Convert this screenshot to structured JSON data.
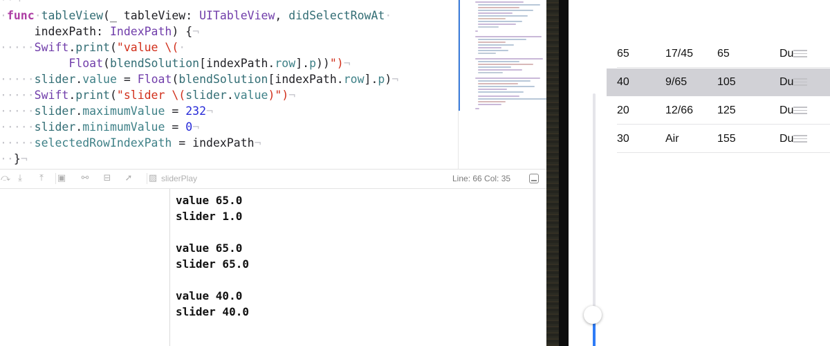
{
  "editor": {
    "lines": {
      "l1a": "func",
      "l1b": "tableView",
      "l1c": "(_ tableView: ",
      "l1d": "UITableView",
      "l1e": ", ",
      "l1f": "didSelectRowAt",
      "l2a": "indexPath: ",
      "l2b": "IndexPath",
      "l2c": ") {",
      "l3a": "Swift",
      "l3b": ".",
      "l3c": "print",
      "l3d": "(",
      "l3e": "\"value \\(",
      "l4a": "Float",
      "l4b": "(",
      "l4c": "blendSolution",
      "l4d": "[indexPath.",
      "l4e": "row",
      "l4f": "].",
      "l4g": "p",
      "l4h": "))",
      "l4i": "\")",
      "l5a": "slider",
      "l5b": ".",
      "l5c": "value",
      "l5d": " = ",
      "l5e": "Float",
      "l5f": "(",
      "l5g": "blendSolution",
      "l5h": "[indexPath.",
      "l5i": "row",
      "l5j": "].",
      "l5k": "p",
      "l5l": ")",
      "l6a": "Swift",
      "l6b": ".",
      "l6c": "print",
      "l6d": "(",
      "l6e": "\"slider \\(",
      "l6f": "slider",
      "l6g": ".",
      "l6h": "value",
      "l6i": ")\")",
      "l7a": "slider",
      "l7b": ".",
      "l7c": "maximumValue",
      "l7d": " = ",
      "l7e": "232",
      "l8a": "slider",
      "l8b": ".",
      "l8c": "minimumValue",
      "l8d": " = ",
      "l8e": "0",
      "l9a": "selectedRowIndexPath",
      "l9b": " = indexPath",
      "l10a": "}"
    }
  },
  "statusbar": {
    "target_label": "sliderPlay",
    "line_col": "Line: 66  Col: 35"
  },
  "console": {
    "lines": [
      "value 65.0",
      "slider 1.0",
      "value 65.0",
      "slider 65.0",
      "value 40.0",
      "slider 40.0"
    ]
  },
  "table": {
    "rows": [
      {
        "c1": "65",
        "c2": "17/45",
        "c3": "65",
        "c4": "Du",
        "selected": false
      },
      {
        "c1": "40",
        "c2": "9/65",
        "c3": "105",
        "c4": "Du",
        "selected": true
      },
      {
        "c1": "20",
        "c2": "12/66",
        "c3": "125",
        "c4": "Du",
        "selected": false
      },
      {
        "c1": "30",
        "c2": "Air",
        "c3": "155",
        "c4": "Du",
        "selected": false
      }
    ]
  },
  "slider": {
    "value": 40,
    "min": 0,
    "max": 232
  },
  "colors": {
    "keyword": "#ad3da4",
    "type": "#703daa",
    "string": "#d12f1b",
    "number": "#272ad8",
    "accent": "#2f7cf6",
    "selected_row": "#d1d1d6"
  }
}
